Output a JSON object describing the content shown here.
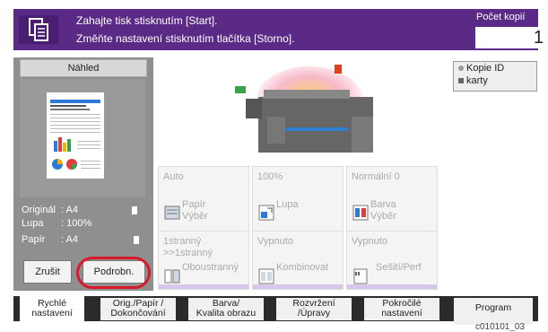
{
  "header": {
    "msg1": "Zahajte tisk stisknutím [Start].",
    "msg2": "Změňte nastavení stisknutím tlačítka [Storno].",
    "copies_label": "Počet kopií",
    "copies_value": "1"
  },
  "preview": {
    "button_label": "Náhled",
    "info": [
      {
        "key": "Originál",
        "value": ": A4"
      },
      {
        "key": "Lupa",
        "value": ": 100%"
      },
      {
        "key": "Papír",
        "value": ": A4"
      }
    ],
    "cancel_label": "Zrušit",
    "details_label": "Podrobn."
  },
  "kopie_id": {
    "line1": "Kopie ID",
    "line2": "karty"
  },
  "tiles": [
    {
      "value": "Auto",
      "label1": "Papír",
      "label2": "Výběr",
      "icon": "paper-icon"
    },
    {
      "value": "100%",
      "label1": "Lupa",
      "label2": "",
      "icon": "zoom-icon"
    },
    {
      "value": "Normální 0",
      "label1": "Barva",
      "label2": "Výběr",
      "icon": "color-icon"
    },
    {
      "value": "1stranný\n>>1stranný",
      "label1": "Oboustranný",
      "label2": "",
      "icon": "duplex-icon"
    },
    {
      "value": "Vypnuto",
      "label1": "Kombinovat",
      "label2": "",
      "icon": "combine-icon"
    },
    {
      "value": "Vypnuto",
      "label1": "Sešití/Perf",
      "label2": "",
      "icon": "staple-icon"
    }
  ],
  "tabs": [
    {
      "line1": "Rychlé",
      "line2": "nastavení"
    },
    {
      "line1": "Orig./Papír /",
      "line2": "Dokončování"
    },
    {
      "line1": "Barva/",
      "line2": "Kvalita obrazu"
    },
    {
      "line1": "Rozvržení",
      "line2": "/Úpravy"
    },
    {
      "line1": "Pokročilé",
      "line2": "nastavení"
    },
    {
      "line1": "Program",
      "line2": ""
    }
  ],
  "footer_code": "c010101_03",
  "colors": {
    "header": "#5b2a86",
    "accent": "#d7192a",
    "tile_bar": "#d7c8ea"
  }
}
